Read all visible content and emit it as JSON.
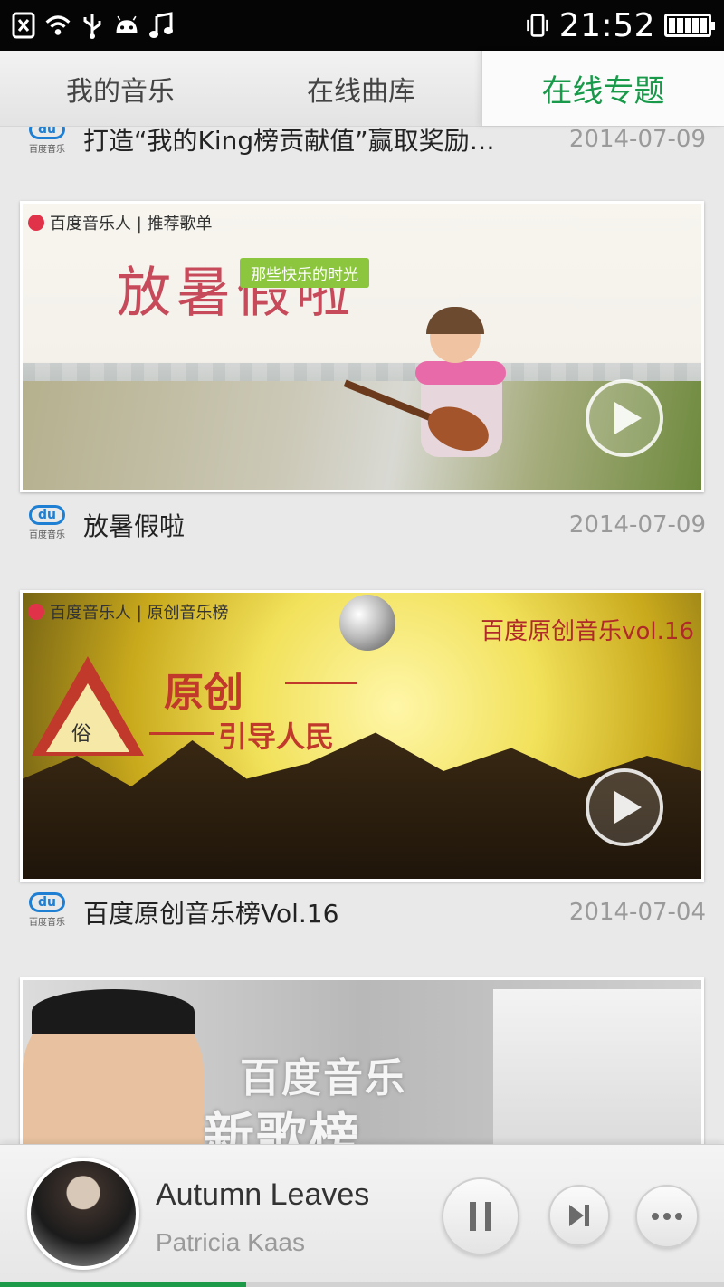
{
  "status_bar": {
    "time": "21:52",
    "icons": [
      "sim-missing-icon",
      "wifi-icon",
      "usb-icon",
      "android-icon",
      "music-note-icon",
      "vibrate-icon",
      "battery-icon"
    ]
  },
  "tabs": [
    {
      "label": "我的音乐",
      "active": false
    },
    {
      "label": "在线曲库",
      "active": false
    },
    {
      "label": "在线专题",
      "active": true
    }
  ],
  "brand": {
    "logo_text": "du",
    "logo_sub": "百度音乐"
  },
  "partial_item": {
    "title": "打造“我的King榜贡献值”赢取奖励…",
    "date": "2014-07-09"
  },
  "items": [
    {
      "banner": {
        "brand_tag": "百度音乐人 | 推荐歌单",
        "headline": "放暑假啦",
        "ribbon": "那些快乐的时光"
      },
      "title": "放暑假啦",
      "date": "2014-07-09"
    },
    {
      "banner": {
        "brand_tag": "百度音乐人 | 原创音乐榜",
        "headline_1": "原创",
        "headline_2": "引导人民",
        "series": "百度原创音乐vol.16",
        "sign": "俗"
      },
      "title": "百度原创音乐榜Vol.16",
      "date": "2014-07-04"
    },
    {
      "banner": {
        "line_1": "百度音乐",
        "line_2": "新歌榜"
      }
    }
  ],
  "player": {
    "title": "Autumn Leaves",
    "artist": "Patricia Kaas",
    "progress": 0.34
  },
  "colors": {
    "accent": "#199a4a",
    "progress": "#1c9a48",
    "brand_blue": "#1f7fd2"
  }
}
